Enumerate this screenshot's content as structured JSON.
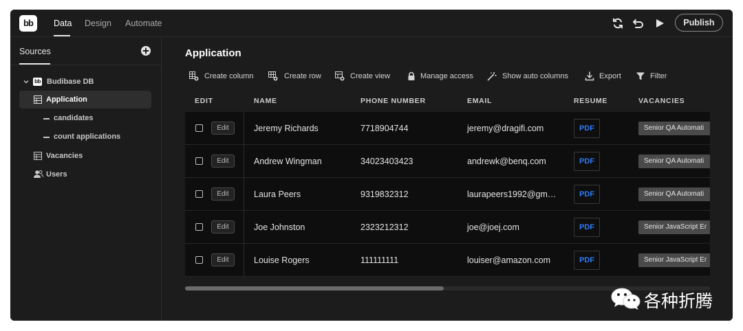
{
  "topbar": {
    "logo": "bb",
    "tabs": [
      "Data",
      "Design",
      "Automate"
    ],
    "active_tab": "Data",
    "publish_label": "Publish"
  },
  "sidebar": {
    "title": "Sources",
    "db_badge": "bb",
    "db_name": "Budibase DB",
    "items": [
      {
        "label": "Application",
        "icon": "table-icon",
        "selected": true
      },
      {
        "label": "candidates",
        "icon": "dash-icon"
      },
      {
        "label": "count applications",
        "icon": "dash-icon"
      },
      {
        "label": "Vacancies",
        "icon": "table-icon"
      },
      {
        "label": "Users",
        "icon": "users-icon"
      }
    ]
  },
  "main": {
    "title": "Application",
    "actions": [
      "Create column",
      "Create row",
      "Create view",
      "Manage access",
      "Show auto columns",
      "Export",
      "Filter"
    ],
    "columns": [
      "EDIT",
      "NAME",
      "PHONE NUMBER",
      "EMAIL",
      "RESUME",
      "VACANCIES"
    ],
    "edit_label": "Edit",
    "pdf_label": "PDF",
    "rows": [
      {
        "name": "Jeremy Richards",
        "phone": "7718904744",
        "email": "jeremy@dragifi.com",
        "vacancy": "Senior QA Automati"
      },
      {
        "name": "Andrew Wingman",
        "phone": "34023403423",
        "email": "andrewk@benq.com",
        "vacancy": "Senior QA Automati"
      },
      {
        "name": "Laura Peers",
        "phone": "9319832312",
        "email": "laurapeers1992@gm…",
        "vacancy": "Senior QA Automati"
      },
      {
        "name": "Joe Johnston",
        "phone": "2323212312",
        "email": "joe@joej.com",
        "vacancy": "Senior JavaScript Er"
      },
      {
        "name": "Louise Rogers",
        "phone": "111111111",
        "email": "louiser@amazon.com",
        "vacancy": "Senior JavaScript Er"
      }
    ]
  },
  "watermark": {
    "text": "各种折腾"
  },
  "colors": {
    "background": "#1c1c1c",
    "table_body": "#0e0e0e",
    "pdf_link": "#2e7bf6",
    "badge": "#4a4a4a"
  }
}
